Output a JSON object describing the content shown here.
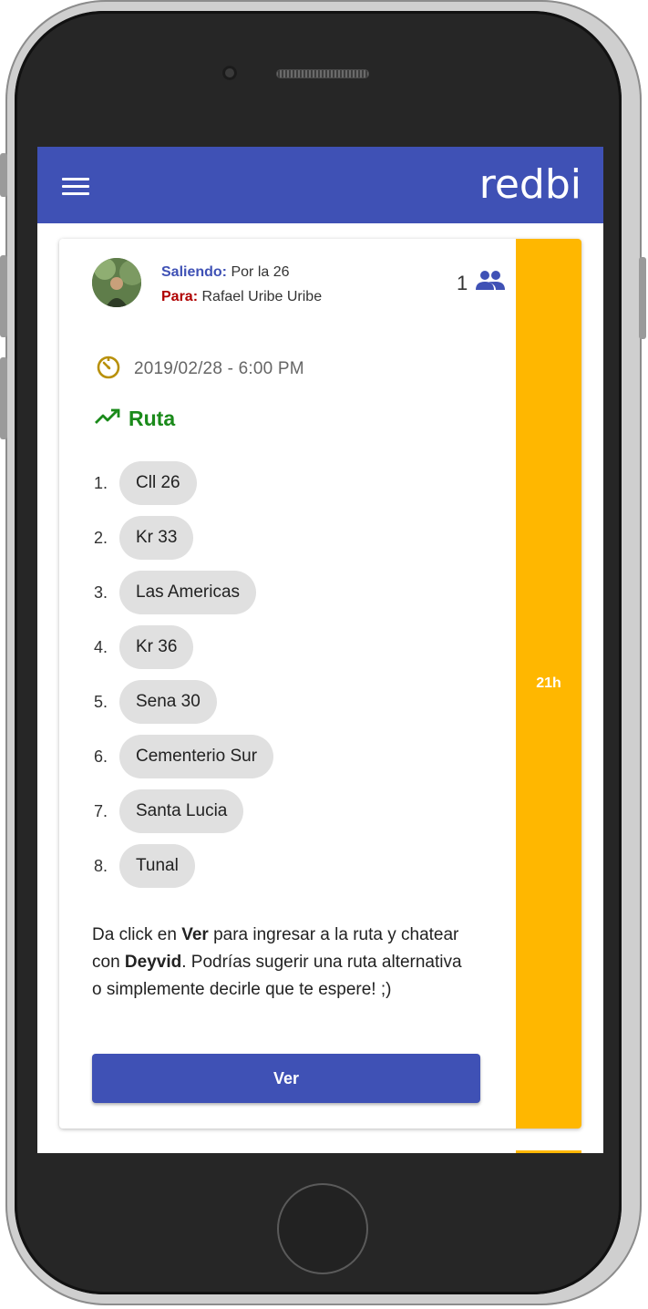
{
  "app": {
    "logo_text": "redbi",
    "brand_color": "#3f51b5",
    "accent_color": "#ffb700"
  },
  "trip": {
    "leaving_label": "Saliendo:",
    "leaving_value": "Por la 26",
    "to_label": "Para:",
    "to_value": "Rafael Uribe Uribe",
    "passenger_count": "1",
    "datetime": "2019/02/28 - 6:00 PM",
    "time_ago": "21h"
  },
  "route": {
    "title": "Ruta",
    "stops": [
      {
        "num": "1.",
        "name": "Cll 26"
      },
      {
        "num": "2.",
        "name": "Kr 33"
      },
      {
        "num": "3.",
        "name": "Las Americas"
      },
      {
        "num": "4.",
        "name": "Kr 36"
      },
      {
        "num": "5.",
        "name": "Sena 30"
      },
      {
        "num": "6.",
        "name": "Cementerio Sur"
      },
      {
        "num": "7.",
        "name": "Santa Lucia"
      },
      {
        "num": "8.",
        "name": "Tunal"
      }
    ]
  },
  "message": {
    "part1": "Da click en ",
    "bold1": "Ver",
    "part2": " para ingresar a la ruta y chatear con ",
    "bold2": "Deyvid",
    "part3": ". Podrías sugerir una ruta alternativa o simplemente decirle que te espere! ;)"
  },
  "actions": {
    "ver_label": "Ver"
  }
}
